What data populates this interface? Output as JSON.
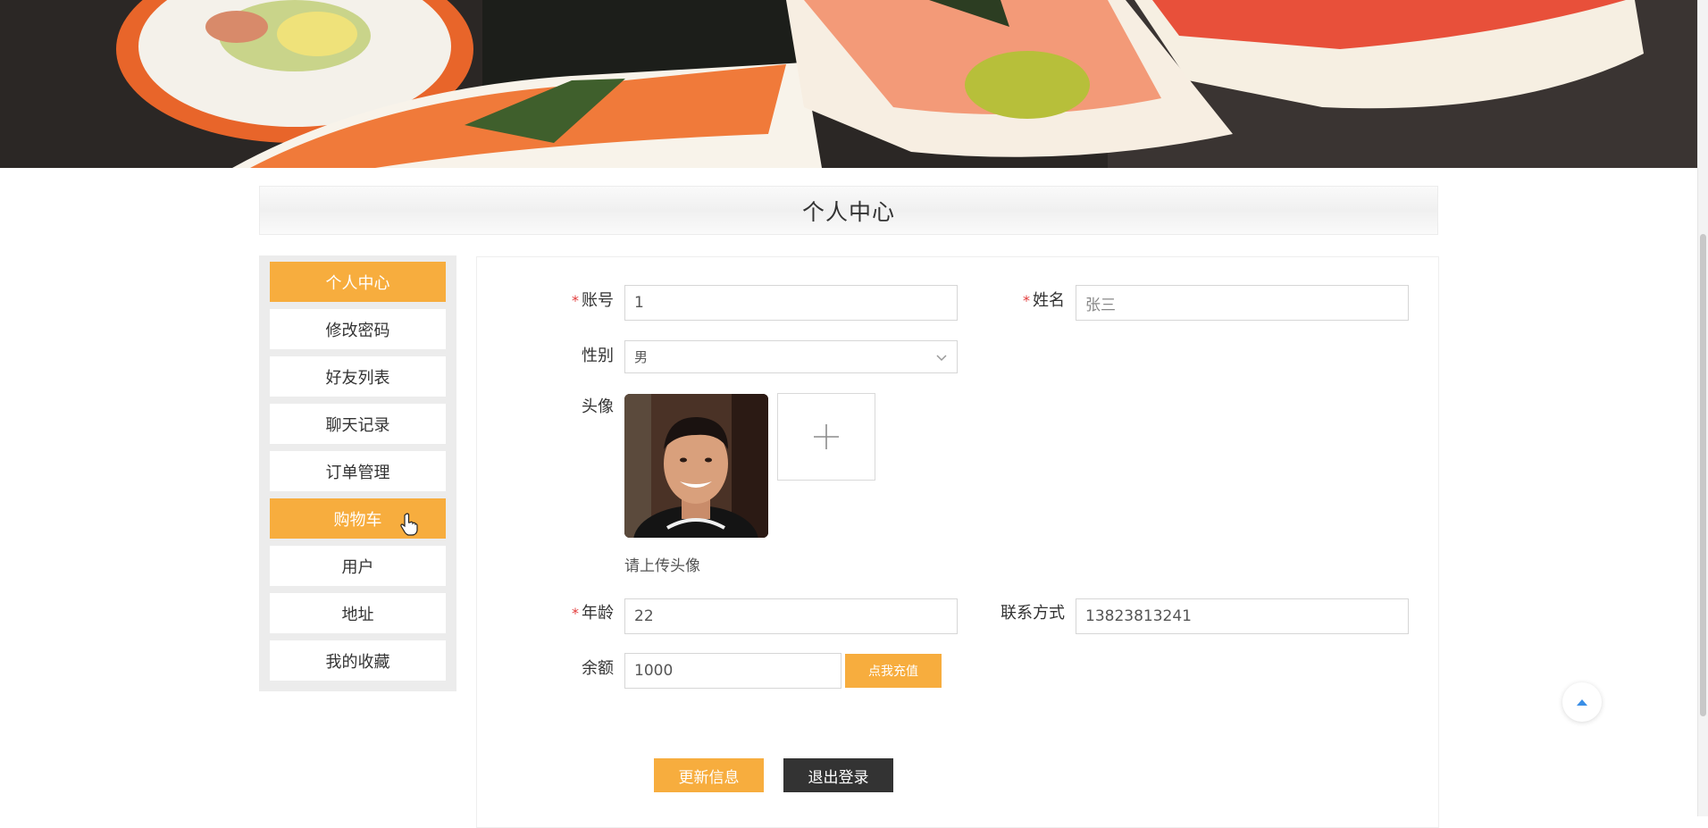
{
  "page": {
    "title": "个人中心"
  },
  "colors": {
    "accent": "#f7ad3e",
    "dark_button": "#333333",
    "required": "#e23c3c"
  },
  "sidebar": {
    "items": [
      {
        "label": "个人中心",
        "active": true
      },
      {
        "label": "修改密码",
        "active": false
      },
      {
        "label": "好友列表",
        "active": false
      },
      {
        "label": "聊天记录",
        "active": false
      },
      {
        "label": "订单管理",
        "active": false
      },
      {
        "label": "购物车",
        "active": true
      },
      {
        "label": "用户",
        "active": false
      },
      {
        "label": "地址",
        "active": false
      },
      {
        "label": "我的收藏",
        "active": false
      }
    ]
  },
  "form": {
    "account": {
      "label": "账号",
      "value": "1",
      "required": true
    },
    "name": {
      "label": "姓名",
      "value": "张三",
      "required": true
    },
    "gender": {
      "label": "性别",
      "value": "男",
      "icon": "chevron-down-icon"
    },
    "avatar": {
      "label": "头像",
      "hint": "请上传头像",
      "upload_icon": "plus-icon"
    },
    "age": {
      "label": "年龄",
      "value": "22",
      "required": true
    },
    "contact": {
      "label": "联系方式",
      "value": "13823813241"
    },
    "balance": {
      "label": "余额",
      "value": "1000",
      "recharge_label": "点我充值"
    }
  },
  "actions": {
    "update_label": "更新信息",
    "logout_label": "退出登录"
  },
  "back_to_top": {
    "icon": "caret-up-icon"
  }
}
